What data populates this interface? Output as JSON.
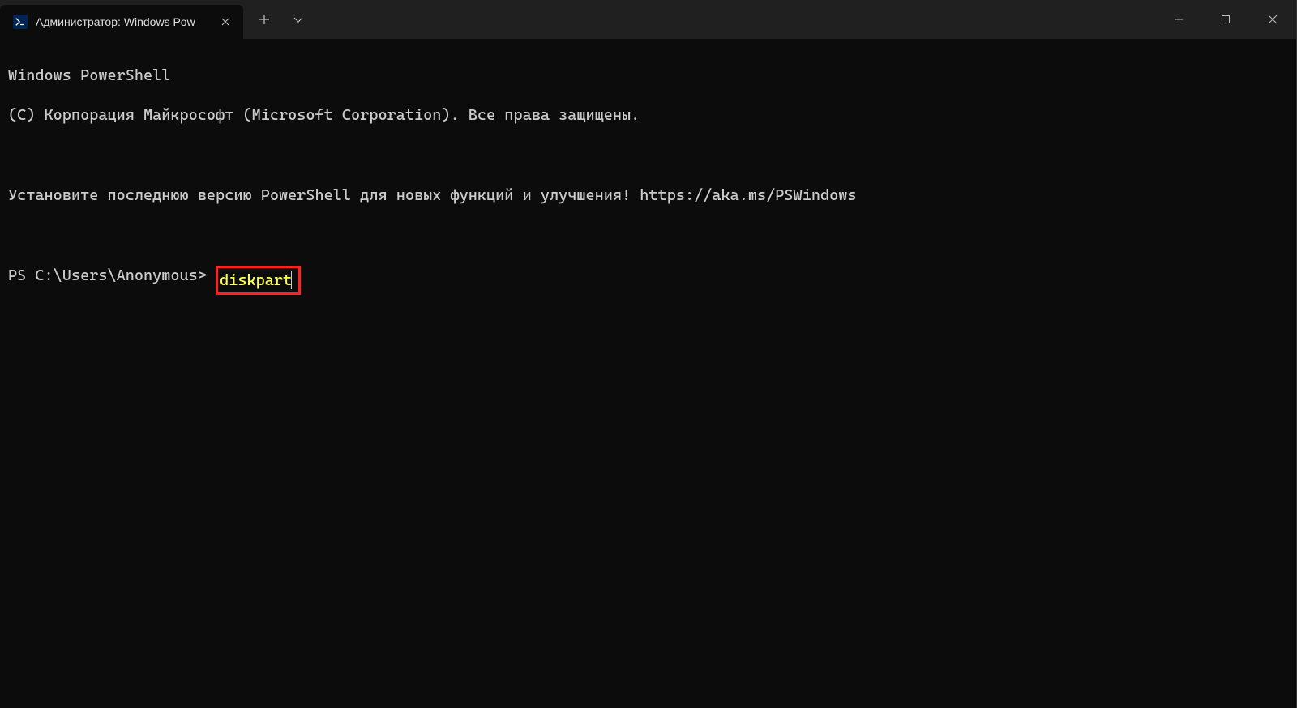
{
  "titlebar": {
    "tab": {
      "title": "Администратор: Windows Pow",
      "icon": "powershell-icon"
    }
  },
  "terminal": {
    "lines": [
      "Windows PowerShell",
      "(C) Корпорация Майкрософт (Microsoft Corporation). Все права защищены.",
      "",
      "Установите последнюю версию PowerShell для новых функций и улучшения! https://aka.ms/PSWindows",
      ""
    ],
    "prompt": "PS C:\\Users\\Anonymous> ",
    "command": "diskpart"
  },
  "colors": {
    "highlight_border": "#ff2020",
    "command_text": "#ffff55",
    "terminal_bg": "#0c0c0c",
    "titlebar_bg": "#202020"
  }
}
